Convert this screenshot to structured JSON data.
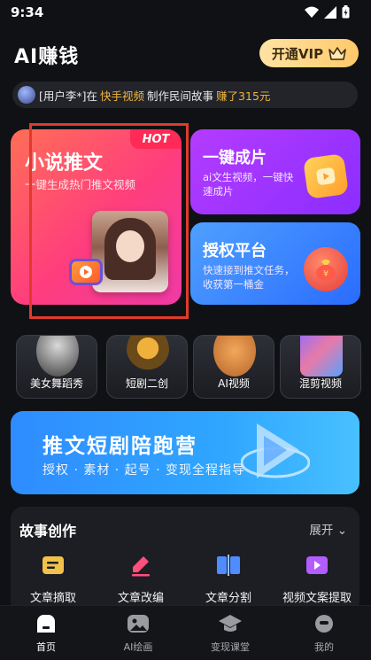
{
  "status": {
    "time": "9:34"
  },
  "header": {
    "title": "AI赚钱",
    "vip_label": "开通VIP"
  },
  "ticker": {
    "prefix": "[用户李*]在",
    "platform": "快手视频",
    "action": "制作民间故事",
    "earned": "赚了315元"
  },
  "cards": {
    "big": {
      "badge": "HOT",
      "title": "小说推文",
      "subtitle": "一键生成热门推文视频"
    },
    "right_top": {
      "title": "一键成片",
      "subtitle": "ai文生视频，一键快速成片"
    },
    "right_bottom": {
      "title": "授权平台",
      "subtitle": "快速接到推文任务，收获第一桶金"
    }
  },
  "categories": [
    {
      "label": "美女舞蹈秀",
      "icon": "dancer-icon"
    },
    {
      "label": "短剧二创",
      "icon": "film-reel-icon"
    },
    {
      "label": "AI视频",
      "icon": "fox-icon"
    },
    {
      "label": "混剪视频",
      "icon": "video-collage-icon"
    }
  ],
  "banner": {
    "title": "推文短剧陪跑营",
    "subtitle": "授权 · 素材 · 起号 · 变现全程指导"
  },
  "story_section": {
    "title": "故事创作",
    "expand_label": "展开",
    "tools": [
      {
        "label": "文章摘取",
        "icon": "extract-icon",
        "color": "#f2c14a"
      },
      {
        "label": "文章改编",
        "icon": "edit-icon",
        "color": "#ff4f7b"
      },
      {
        "label": "文章分割",
        "icon": "split-icon",
        "color": "#4e8cff"
      },
      {
        "label": "视频文案提取",
        "icon": "video-text-icon",
        "color": "#b35cff"
      }
    ]
  },
  "tabbar": [
    {
      "label": "首页",
      "icon": "home-icon",
      "active": true
    },
    {
      "label": "AI绘画",
      "icon": "image-icon",
      "active": false
    },
    {
      "label": "变现课堂",
      "icon": "graduation-cap-icon",
      "active": false
    },
    {
      "label": "我的",
      "icon": "profile-icon",
      "active": false
    }
  ]
}
